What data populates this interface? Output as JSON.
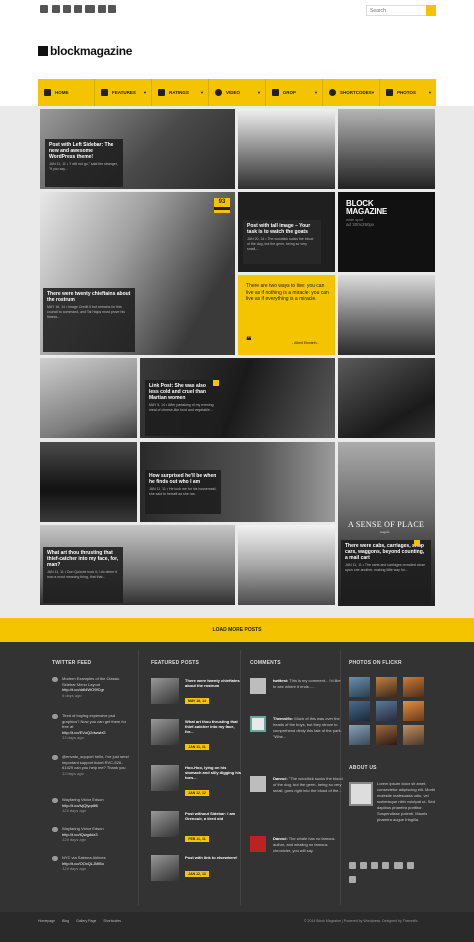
{
  "search": {
    "placeholder": "Search"
  },
  "brand": {
    "logo": "blockmagazine",
    "accent": "#f5c400"
  },
  "nav": {
    "items": [
      {
        "label": "HOME",
        "icon": "home-icon"
      },
      {
        "label": "FEATURES",
        "icon": "gears-icon"
      },
      {
        "label": "RATINGS",
        "icon": "bars-icon"
      },
      {
        "label": "VIDEO",
        "icon": "play-icon"
      },
      {
        "label": "DROP",
        "icon": "list-icon"
      },
      {
        "label": "SHORTCODES",
        "icon": "globe-icon"
      },
      {
        "label": "PHOTOS",
        "icon": "camera-icon"
      }
    ]
  },
  "tiles": {
    "t1": {
      "title": "Post with Left Sidebar: The new and awesome WordPress theme!",
      "meta": "JAN 11, 11 • \"I will not go,\" said the stranger, \"if you say..."
    },
    "t4": {
      "badge": "93",
      "title": "There were twenty chieftains about the rostrum",
      "meta": "MAY 16, 14 • Image Credit It but remains for this council to command, and Tal Hajus must prove his fitness..."
    },
    "t5": {
      "title": "Post with tall image – Your task is to watch the goats",
      "meta": "JAN 20, 14 • The woodtick sucks the blood of the dog, but the germ, being so very small,..."
    },
    "ad": {
      "l1": "BLOCK",
      "l2": "MAGAZINE",
      "l3": "wide spot",
      "l4": "ad 300x250px"
    },
    "t7": {
      "quote": "There are two ways to live: you can live as if nothing is a miracle: you can live as if everything is a miracle.",
      "author": "- Albert Einstein -"
    },
    "t10": {
      "title": "Link Post: She was also less cold and cruel than Martian women",
      "meta": "MAY 5, 14 • After partaking of my evening meal of cheese-like food and vegetable..."
    },
    "t13": {
      "title": "How surprised he'll be when he finds out who I am",
      "meta": "JAN 11, 11 • He took me for his housemaid, she said to herself as she ran."
    },
    "t14": {
      "headline": "A SENSE OF PLACE",
      "sub": "August",
      "title": "There were cabs, carriages, shop cars, waggons, beyond counting, a mail cart",
      "meta": "JAN 11, 11 • The carts and carriages crowded close upon one another, making little way for..."
    },
    "t15": {
      "title": "What art thou thrusting that thief-catcher into my face, for, man?",
      "meta": "JAN 11, 11 • Don Quixote took it, I do deem it now a most meaning thing, that that..."
    }
  },
  "load_more": "LOAD MORE POSTS",
  "footer": {
    "twitter": {
      "heading": "TWITTER FEED",
      "items": [
        {
          "text": "Modern Examples of the Classic Sidebar Menu Layout",
          "link": "http://t.co/ddI4WO9fCgr",
          "ago": "9 days ago"
        },
        {
          "text": "Tired of buying expensive psd graphics? Now you can get them for free at",
          "link": "http://t.co/EVuQ2dwwbG",
          "ago": "13 days ago"
        },
        {
          "text": "@envato_support hello, I've just send important support ticket RVC-526-61429 can you help me? Thank you",
          "link": "",
          "ago": "13 days ago"
        },
        {
          "text": "Wayfaring Victor Edson",
          "link": "http://t.co/lvjQlyqdll6",
          "ago": "124 days ago"
        },
        {
          "text": "Wayfaring Victor Edson",
          "link": "http://t.co/tQwgddz3",
          "ago": "124 days ago"
        },
        {
          "text": "NYC via Sabena Airlines",
          "link": "http://t.co/OOxQLJMl5o",
          "ago": "124 days ago"
        }
      ]
    },
    "featured": {
      "heading": "FEATURED POSTS",
      "items": [
        {
          "title": "There were twenty chieftains about the rostrum",
          "date": "MAY 16, 14"
        },
        {
          "title": "What art thou thrusting that thief-catcher into my face, for...",
          "date": "JAN 11, 11"
        },
        {
          "title": "Hoo-Hoo, lying on his stomach and silly digging his toes...",
          "date": "JAN 12, 12"
        },
        {
          "title": "Post without Sidebar: I am Grenouir, a tired old",
          "date": "FEB 11, 11"
        },
        {
          "title": "Post with link to elsewhere!",
          "date": "JAN 12, 13"
        }
      ]
    },
    "comments": {
      "heading": "COMMENTS",
      "items": [
        {
          "author": "twittest:",
          "text": "This is my comment... I'd like to see where it ends....."
        },
        {
          "author": "Themnific:",
          "text": "Much of this was over the heads of the boys, but they strove to comprehend dimly this tale of the park. \"Wha..."
        },
        {
          "author": "Dannci:",
          "text": "\"The woodtick sucks the blood of the dog, but the germ, being so very small, goes right into the blood of the..."
        },
        {
          "author": "Dannci:",
          "text": "The whale has no famous author, and whaling no famous chronicler, you will say."
        }
      ]
    },
    "photos": {
      "heading": "PHOTOS ON FLICKR"
    },
    "about": {
      "heading": "ABOUT US",
      "text": "Lorem ipsum dolor sit amet, consectetur adipiscing elit. Morbi molestie malesuada odio, vel scelerisque nibh volutpat ut. Sed dapibus pharetra porttitor. Suspendisse potenti. Mauris pharetra augue fringilla."
    },
    "bottom_links": [
      "Homepage",
      "Blog",
      "Gallery Page",
      "Shortcodes"
    ],
    "copyright": "© 2014 Block Magazine | Powered by Wordpress. Designed by Themnific"
  }
}
